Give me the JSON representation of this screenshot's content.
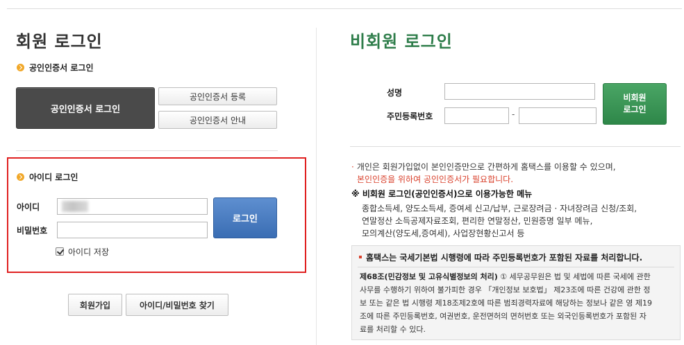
{
  "member": {
    "title": "회원 로그인",
    "cert_section_title": "공인인증서 로그인",
    "cert_login_button": "공인인증서 로그인",
    "cert_register_button": "공인인증서 등록",
    "cert_guide_button": "공인인증서 안내",
    "id_section_title": "아이디 로그인",
    "id_label": "아이디",
    "password_label": "비밀번호",
    "login_button": "로그인",
    "save_id_label": "아이디 저장",
    "save_id_checked": true,
    "join_button": "회원가입",
    "find_button": "아이디/비밀번호 찾기"
  },
  "guest": {
    "title": "비회원 로그인",
    "name_label": "성명",
    "rrn_label": "주민등록번호",
    "rrn_separator": "-",
    "login_button_line1": "비회원",
    "login_button_line2": "로그인",
    "info_line1": "개인은 회원가입없이 본인인증만으로 간편하게 홈택스를 이용할 수 있으며,",
    "info_line2": "본인인증을 위하여 공인인증서가 필요합니다.",
    "available_title": "※ 비회원 로그인(공인인증서)으로 이용가능한 메뉴",
    "available_lines": [
      "종합소득세, 양도소득세, 증여세 신고/납부, 근로장려금 · 자녀장려금 신청/조회,",
      "연말정산 소득공제자료조회, 편리한 연말정산, 민원증명 일부 메뉴,",
      "모의계산(양도세,증여세), 사업장현황신고서 등"
    ],
    "notice_title": "홈택스는 국세기본법 시행령에 따라 주민등록번호가 포함된 자료를 처리합니다.",
    "notice_article": "제68조(민감정보 및 고유식별정보의 처리)",
    "notice_lines": [
      "① 세무공무원은 법 및 세법에 따른 국세에 관한",
      "사무를 수행하기 위하여 불가피한 경우 「개인정보 보호법」 제23조에 따른 건강에 관한 정",
      "보 또는 같은 법 시행령 제18조제2호에 따른 범죄경력자료에 해당하는 정보나 같은 영 제19",
      "조에 따른 주민등록번호, 여권번호, 운전면허의 면허번호 또는 외국인등록번호가 포함된 자",
      "료를 처리할 수 있다."
    ]
  }
}
